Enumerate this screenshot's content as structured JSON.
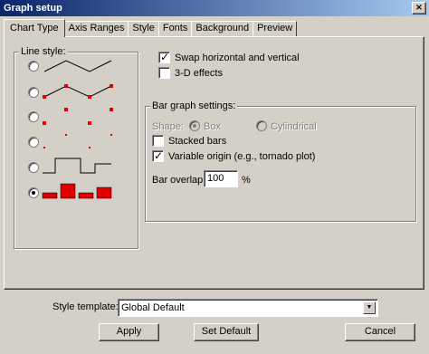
{
  "window": {
    "title": "Graph setup",
    "close_glyph": "×"
  },
  "tabs": [
    {
      "label": "Chart Type"
    },
    {
      "label": "Axis Ranges"
    },
    {
      "label": "Style"
    },
    {
      "label": "Fonts"
    },
    {
      "label": "Background"
    },
    {
      "label": "Preview"
    }
  ],
  "line_style": {
    "title": "Line style:",
    "options": [
      {
        "kind": "line",
        "checked": false
      },
      {
        "kind": "line-with-markers",
        "checked": false
      },
      {
        "kind": "markers-only",
        "checked": false
      },
      {
        "kind": "small-markers",
        "checked": false
      },
      {
        "kind": "step",
        "checked": false
      },
      {
        "kind": "bar",
        "checked": true
      }
    ],
    "marker_color": "#e00000"
  },
  "options": {
    "swap_label": "Swap horizontal and vertical",
    "swap_checked": true,
    "effects_label": "3-D effects",
    "effects_checked": false
  },
  "bar_settings": {
    "title": "Bar graph settings:",
    "shape_label": "Shape:",
    "box_label": "Box",
    "box_selected": true,
    "cylindrical_label": "Cylindrical",
    "cylindrical_selected": false,
    "stacked_label": "Stacked bars",
    "stacked_checked": false,
    "variable_label": "Variable origin (e.g., tornado plot)",
    "variable_checked": true,
    "overlap_label": "Bar overlap:",
    "overlap_value": "100",
    "overlap_unit": "%"
  },
  "footer": {
    "template_label": "Style template:",
    "template_value": "Global Default",
    "apply_label": "Apply",
    "set_default_label": "Set Default",
    "cancel_label": "Cancel"
  },
  "icons": {
    "close": "close-icon",
    "dropdown": "chevron-down-icon"
  }
}
